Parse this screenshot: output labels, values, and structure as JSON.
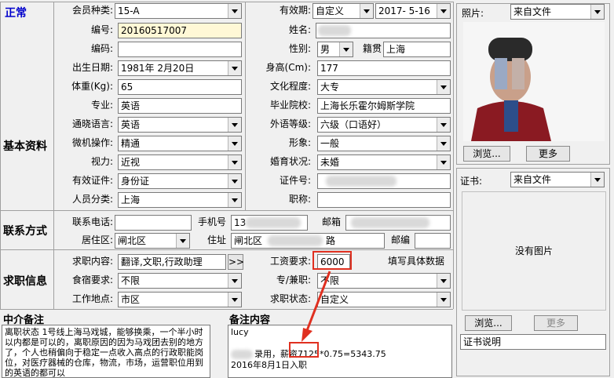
{
  "status": {
    "text": "正常",
    "color": "#0000cc"
  },
  "sections": {
    "basic": "基本资料",
    "contact": "联系方式",
    "job": "求职信息"
  },
  "fields": {
    "member_type": {
      "label": "会员种类:",
      "value": "15-A"
    },
    "validity": {
      "label": "有效期:",
      "value": "自定义",
      "date": "2017- 5-16"
    },
    "id_no": {
      "label": "编号:",
      "value": "20160517007"
    },
    "name": {
      "label": "姓名:"
    },
    "code": {
      "label": "编码:",
      "value": ""
    },
    "gender": {
      "label": "性别:",
      "value": "男"
    },
    "native": {
      "label": "籍贯",
      "value": "上海"
    },
    "birth": {
      "label": "出生日期:",
      "value": "1981年 2月20日"
    },
    "height": {
      "label": "身高(Cm):",
      "value": "177"
    },
    "weight": {
      "label": "体重(Kg):",
      "value": "65"
    },
    "education": {
      "label": "文化程度:",
      "value": "大专"
    },
    "major": {
      "label": "专业:",
      "value": "英语"
    },
    "school": {
      "label": "毕业院校:",
      "value": "上海长乐霍尔姆斯学院"
    },
    "language": {
      "label": "通晓语言:",
      "value": "英语"
    },
    "foreign_level": {
      "label": "外语等级:",
      "value": "六级（口语好）"
    },
    "computer": {
      "label": "微机操作:",
      "value": "精通"
    },
    "appearance": {
      "label": "形象:",
      "value": "一般"
    },
    "vision": {
      "label": "视力:",
      "value": "近视"
    },
    "marital": {
      "label": "婚育状况:",
      "value": "未婚"
    },
    "id_type": {
      "label": "有效证件:",
      "value": "身份证"
    },
    "cert_no": {
      "label": "证件号:"
    },
    "category": {
      "label": "人员分类:",
      "value": "上海"
    },
    "title": {
      "label": "职称:",
      "value": ""
    },
    "phone": {
      "label": "联系电话:",
      "value": ""
    },
    "mobile": {
      "label": "手机号",
      "value": "13"
    },
    "email": {
      "label": "邮箱"
    },
    "district": {
      "label": "居住区:",
      "value": "闸北区"
    },
    "address": {
      "label": "住址",
      "value": "闸北区",
      "tail": "路"
    },
    "postcode": {
      "label": "邮编",
      "value": ""
    },
    "job_content": {
      "label": "求职内容:",
      "value": "翻译,文职,行政助理",
      "more": ">>"
    },
    "salary": {
      "label": "工资要求:",
      "value": "6000",
      "hint": "填写具体数据"
    },
    "board": {
      "label": "食宿要求:",
      "value": "不限"
    },
    "fulltime": {
      "label": "专/兼职:",
      "value": "不限"
    },
    "workplace": {
      "label": "工作地点:",
      "value": "市区"
    },
    "job_status": {
      "label": "求职状态:",
      "value": "自定义"
    }
  },
  "photo": {
    "label": "照片:",
    "source": "来自文件",
    "browse": "浏览...",
    "more": "更多"
  },
  "certificate": {
    "label": "证书:",
    "source": "来自文件",
    "empty": "没有图片",
    "browse": "浏览...",
    "more": "更多",
    "desc": "证书说明"
  },
  "agency_note": {
    "title": "中介备注",
    "text": "离职状态 1号线上海马戏城，能够换乘，一个半小时以内都是可以的，离职原因的因为马戏团去别的地方了，个人也稍偏向于稳定一点收入高点的行政职能岗位，对医疗器械的仓库，物流，市场，运营职位用到的英语的都可以"
  },
  "remark": {
    "title": "备注内容",
    "line1": "lucy",
    "line2": "录用，薪资7125*0.75=5343.75",
    "line3": "2016年8月1日入职"
  },
  "colors": {
    "highlight_box": "#e03020",
    "arrow": "#e03020",
    "id_bg": "#fff8d6"
  }
}
